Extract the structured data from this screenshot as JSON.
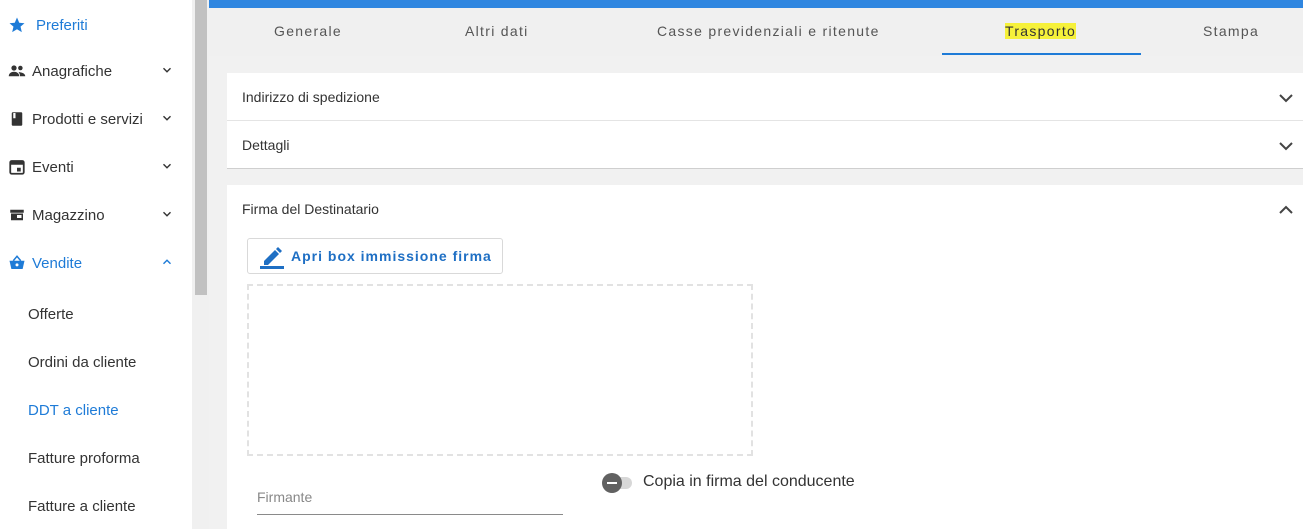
{
  "sidebar": {
    "favorites": "Preferiti",
    "items": [
      {
        "label": "Anagrafiche"
      },
      {
        "label": "Prodotti e servizi"
      },
      {
        "label": "Eventi"
      },
      {
        "label": "Magazzino"
      },
      {
        "label": "Vendite"
      }
    ],
    "sub_items": [
      {
        "label": "Offerte"
      },
      {
        "label": "Ordini da cliente"
      },
      {
        "label": "DDT a cliente"
      },
      {
        "label": "Fatture proforma"
      },
      {
        "label": "Fatture a cliente"
      }
    ]
  },
  "tabs": [
    {
      "label": "Generale"
    },
    {
      "label": "Altri dati"
    },
    {
      "label": "Casse previdenziali e ritenute"
    },
    {
      "label": "Trasporto"
    },
    {
      "label": "Stampa"
    }
  ],
  "panels": {
    "shipping_address": "Indirizzo di spedizione",
    "details": "Dettagli",
    "recipient_signature": "Firma del Destinatario"
  },
  "signature": {
    "open_box_button": "Apri box immissione firma",
    "signer_placeholder": "Firmante",
    "copy_toggle_label": "Copia in firma del conducente"
  },
  "colors": {
    "accent": "#1e7bd7",
    "top_bar": "#2f86e0",
    "highlight": "#f6f13a"
  }
}
